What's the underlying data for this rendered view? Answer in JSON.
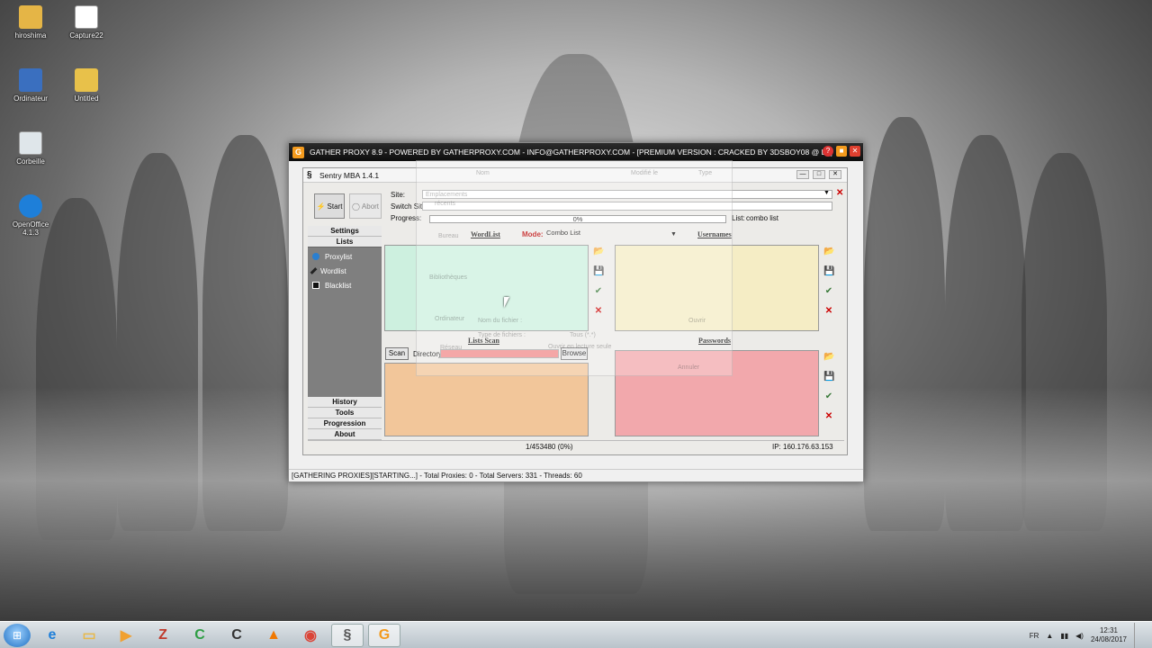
{
  "desktop": {
    "icons": [
      {
        "label": "hiroshima",
        "icon": "folder-icon"
      },
      {
        "label": "Capture22",
        "icon": "image-file-icon"
      },
      {
        "label": "Ordinateur",
        "icon": "computer-icon"
      },
      {
        "label": "Untitled",
        "icon": "file-icon"
      },
      {
        "label": "Corbeille",
        "icon": "recycle-bin-icon"
      },
      {
        "label": "OpenOffice 4.1.3",
        "icon": "openoffice-icon"
      }
    ]
  },
  "gather_proxy": {
    "logo": "G",
    "title": "GATHER PROXY 8.9 - POWERED BY GATHERPROXY.COM - INFO@GATHERPROXY.COM - [PREMIUM VERSION : CRACKED BY 3DSBOY08 @ LF]",
    "status": "[GATHERING PROXIES][STARTING...] - Total Proxies: 0 - Total Servers: 331 - Threads: 60"
  },
  "sentry": {
    "title": "Sentry MBA 1.4.1",
    "start_label": "Start",
    "abort_label": "Abort",
    "site_label": "Site:",
    "switch_site_label": "Switch Site:",
    "progress_label": "Progress:",
    "progress_text": "0%",
    "progress_value": 0,
    "list_label": "List:",
    "list_value": "combo list",
    "sidebar": {
      "settings": "Settings",
      "lists": "Lists",
      "items": [
        "Proxylist",
        "Wordlist",
        "Blacklist"
      ],
      "bottom": [
        "History",
        "Tools",
        "Progression",
        "About"
      ]
    },
    "wordlist_label": "WordList",
    "mode_label": "Mode:",
    "mode_value": "Combo List",
    "usernames_label": "Usernames",
    "lists_scan_label": "Lists Scan",
    "passwords_label": "Passwords",
    "scan_button": "Scan",
    "directory_label": "Directory",
    "browse_button": "Browse",
    "status_count": "1/453480 (0%)",
    "status_ip": "IP: 160.176.63.153"
  },
  "ghost_dialog": {
    "header_name": "Nom",
    "header_modified": "Modifié le",
    "header_type": "Type",
    "item1": "Emplacements",
    "item2": "récents",
    "item3": "Bureau",
    "item4": "Bibliothèques",
    "item5": "Ordinateur",
    "item6": "Réseau",
    "filename_label": "Nom du fichier :",
    "filetype_label": "Type de fichiers :",
    "filetype_value": "Tous (*.*)",
    "readonly_label": "Ouvrir en lecture seule",
    "open_button": "Ouvrir",
    "cancel_button": "Annuler"
  },
  "taskbar": {
    "apps": [
      {
        "name": "ie-icon",
        "glyph": "e",
        "color": "#1e7fd9"
      },
      {
        "name": "explorer-icon",
        "glyph": "▭",
        "color": "#e7b84a"
      },
      {
        "name": "media-player-icon",
        "glyph": "▶",
        "color": "#f0a030"
      },
      {
        "name": "filezilla-icon",
        "glyph": "Z",
        "color": "#c0392b"
      },
      {
        "name": "camtasia-icon",
        "glyph": "C",
        "color": "#2e9e44"
      },
      {
        "name": "terminal-icon",
        "glyph": "C",
        "color": "#333333"
      },
      {
        "name": "vlc-icon",
        "glyph": "▲",
        "color": "#f07800"
      },
      {
        "name": "chrome-icon",
        "glyph": "◉",
        "color": "#db4437"
      },
      {
        "name": "sentry-icon",
        "glyph": "§",
        "color": "#555555"
      },
      {
        "name": "gatherproxy-icon",
        "glyph": "G",
        "color": "#f39a1d"
      }
    ],
    "lang": "FR",
    "time": "12:31",
    "date": "24/08/2017"
  }
}
